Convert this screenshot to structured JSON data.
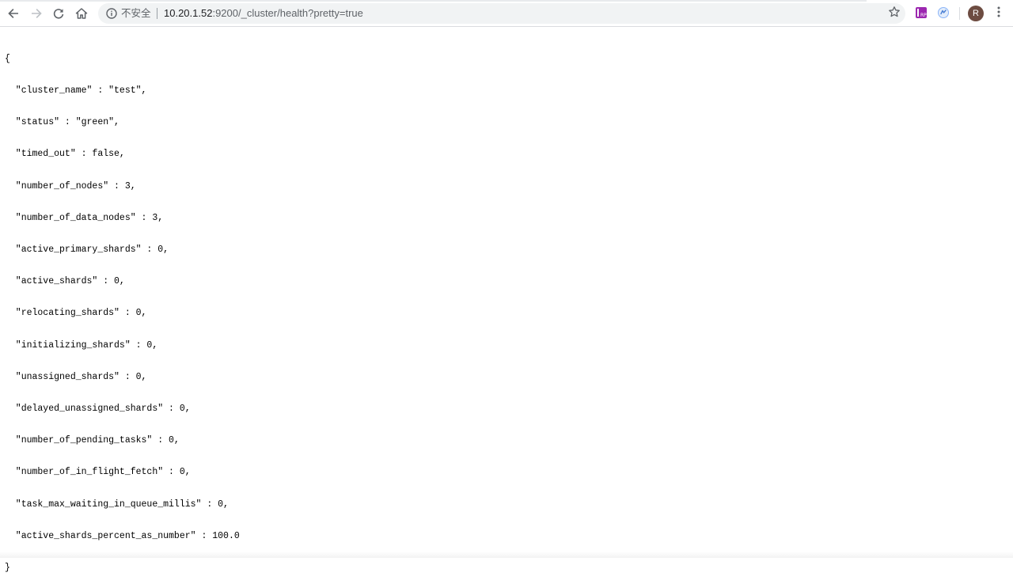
{
  "browser": {
    "security_label": "不安全",
    "url_host": "10.20.1.52",
    "url_rest": ":9200/_cluster/health?pretty=true",
    "avatar_letter": "R",
    "icons": {
      "back": "arrow-left-icon",
      "forward": "arrow-right-icon",
      "reload": "reload-icon",
      "home": "home-icon",
      "info": "info-icon",
      "bookmark": "star-icon",
      "extension_1": "rp-extension-icon",
      "extension_2": "extension-icon",
      "menu": "kebab-menu-icon"
    },
    "colors": {
      "accent_extension": "#9c27b0",
      "avatar": "#6d4c41"
    }
  },
  "document": {
    "lines": [
      "{",
      "  \"cluster_name\" : \"test\",",
      "  \"status\" : \"green\",",
      "  \"timed_out\" : false,",
      "  \"number_of_nodes\" : 3,",
      "  \"number_of_data_nodes\" : 3,",
      "  \"active_primary_shards\" : 0,",
      "  \"active_shards\" : 0,",
      "  \"relocating_shards\" : 0,",
      "  \"initializing_shards\" : 0,",
      "  \"unassigned_shards\" : 0,",
      "  \"delayed_unassigned_shards\" : 0,",
      "  \"number_of_pending_tasks\" : 0,",
      "  \"number_of_in_flight_fetch\" : 0,",
      "  \"task_max_waiting_in_queue_millis\" : 0,",
      "  \"active_shards_percent_as_number\" : 100.0",
      "}"
    ]
  }
}
